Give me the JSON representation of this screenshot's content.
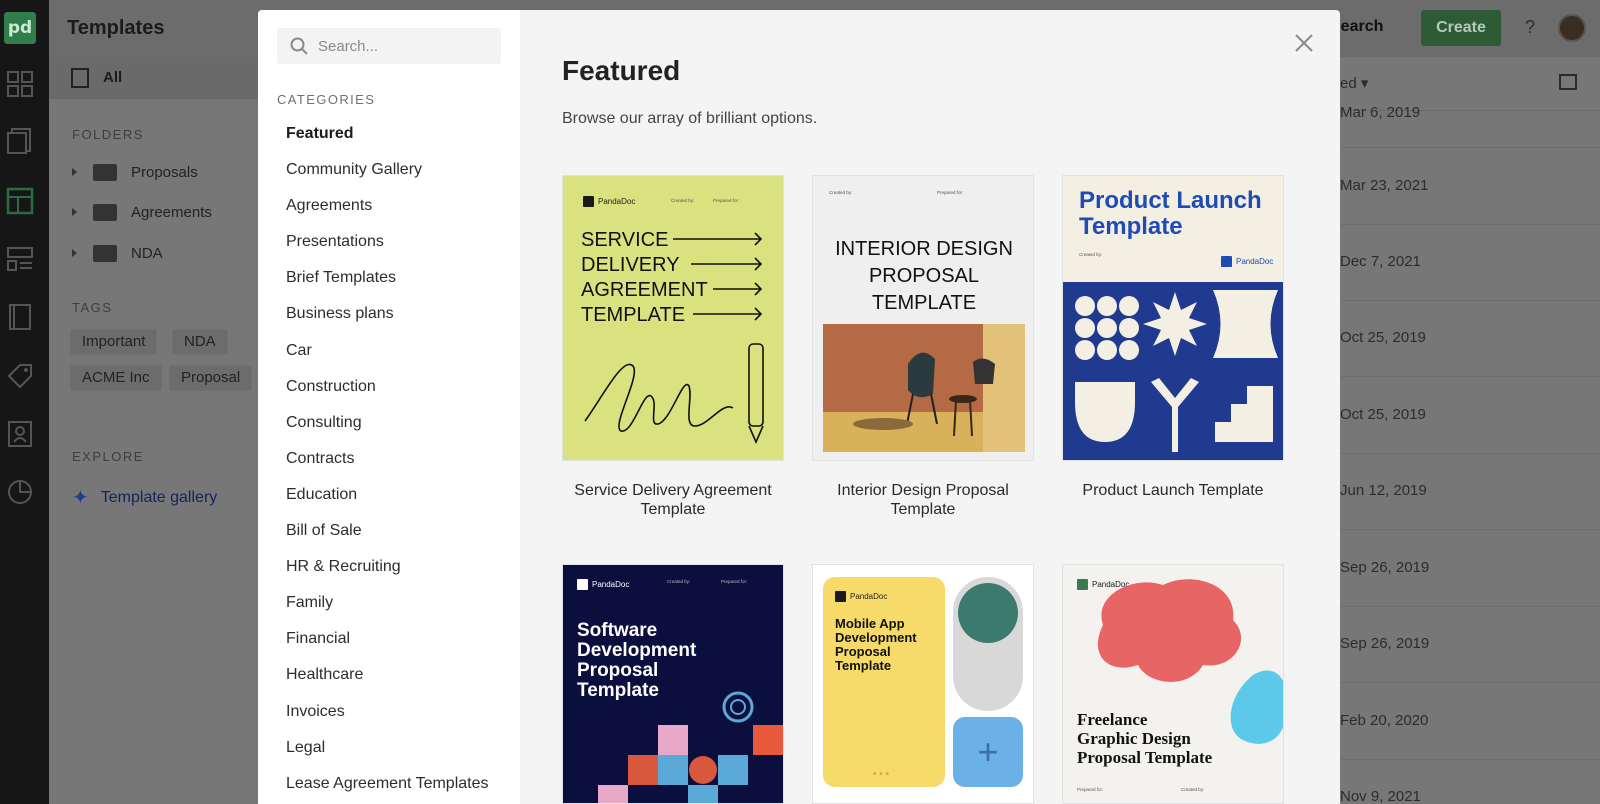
{
  "app": {
    "page_title": "Templates",
    "nav_all": "All",
    "folders_heading": "FOLDERS",
    "folders": [
      "Proposals",
      "Agreements",
      "NDA"
    ],
    "tags_heading": "TAGS",
    "tags": [
      "Important",
      "NDA",
      "ACME Inc",
      "Proposal"
    ],
    "explore_heading": "EXPLORE",
    "template_gallery": "Template gallery",
    "search_button": "Search",
    "create_button": "Create",
    "help": "?",
    "sort_label": "ed",
    "dates": [
      "Mar 6, 2019",
      "Mar 23, 2021",
      "Dec 7, 2021",
      "Oct 25, 2019",
      "Oct 25, 2019",
      "Jun 12, 2019",
      "Sep 26, 2019",
      "Sep 26, 2019",
      "Feb 20, 2020",
      "Nov 9, 2021"
    ],
    "brand_color": "#2e7d4a"
  },
  "modal": {
    "search_placeholder": "Search...",
    "categories_heading": "CATEGORIES",
    "categories": [
      "Featured",
      "Community Gallery",
      "Agreements",
      "Presentations",
      "Brief Templates",
      "Business plans",
      "Car",
      "Construction",
      "Consulting",
      "Contracts",
      "Education",
      "Bill of Sale",
      "HR & Recruiting",
      "Family",
      "Financial",
      "Healthcare",
      "Invoices",
      "Legal",
      "Lease Agreement Templates"
    ],
    "active_category": "Featured",
    "title": "Featured",
    "subtitle": "Browse our array of brilliant options.",
    "templates": [
      {
        "caption": "Service Delivery Agreement Template",
        "art_lines": [
          "SERVICE",
          "DELIVERY",
          "AGREEMENT",
          "TEMPLATE"
        ],
        "bg": "#d9e27f"
      },
      {
        "caption": "Interior Design Proposal Template",
        "art_lines": [
          "INTERIOR DESIGN",
          "PROPOSAL",
          "TEMPLATE"
        ],
        "bg": "#efefef"
      },
      {
        "caption": "Product Launch Template",
        "art_lines": [
          "Product Launch",
          "Template"
        ],
        "bg": "#1f3a8f"
      },
      {
        "caption": "Software Development Proposal Template",
        "art_lines": [
          "Software",
          "Development",
          "Proposal",
          "Template"
        ],
        "bg": "#0a0f3d"
      },
      {
        "caption": "Mobile App Development Proposal Template",
        "art_lines": [
          "Mobile App",
          "Development",
          "Proposal",
          "Template"
        ],
        "bg": "#f7db6a"
      },
      {
        "caption": "Freelance Graphic Design Proposal Template",
        "art_lines": [
          "Freelance",
          "Graphic Design",
          "Proposal Template"
        ],
        "bg": "#f4f2ee"
      }
    ],
    "brand_text": "PandaDoc",
    "created_by": "Created by:",
    "prepared_for": "Prepared for:",
    "sender_fields": "[Sender.FirstName] [Sender.LastName] [Sender.Company]",
    "client_fields": "[Client.FirstName] [Client.LastName] [Client.Company]"
  }
}
